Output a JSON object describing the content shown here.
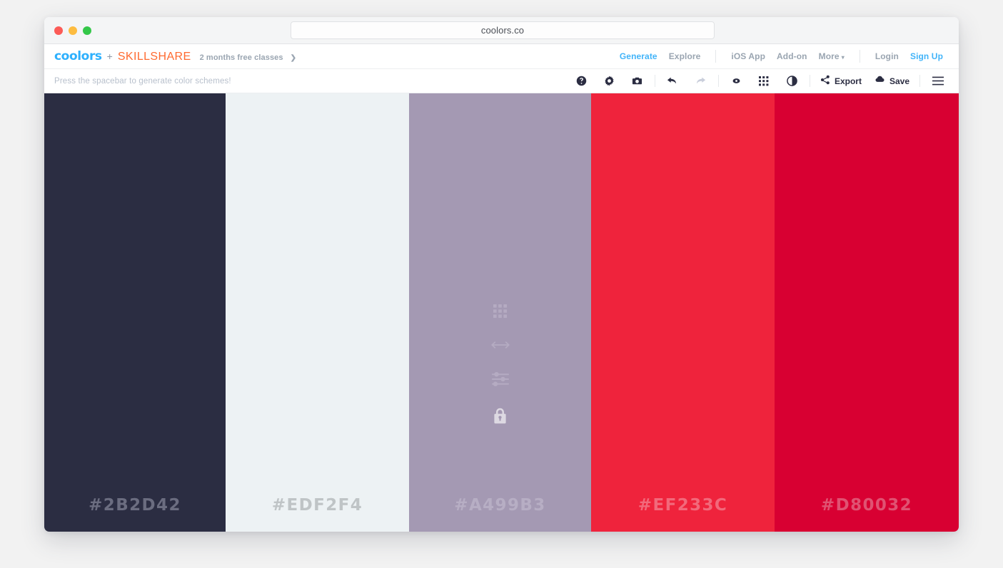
{
  "browser": {
    "url": "coolors.co",
    "traffic_lights": [
      "close-red",
      "minimize-yellow",
      "maximize-green"
    ]
  },
  "header": {
    "logo": "coolors",
    "plus": "+",
    "partner": "SKILLSHARE",
    "promo": "2 months free classes",
    "promo_arrow": "❯",
    "nav_primary": [
      {
        "label": "Generate",
        "active": true
      },
      {
        "label": "Explore",
        "active": false
      }
    ],
    "nav_secondary": [
      {
        "label": "iOS App",
        "caret": false
      },
      {
        "label": "Add-on",
        "caret": false
      },
      {
        "label": "More",
        "caret": true
      }
    ],
    "nav_account": [
      {
        "label": "Login",
        "accent": false
      },
      {
        "label": "Sign Up",
        "accent": true
      }
    ],
    "caret_glyph": "▾"
  },
  "toolbar": {
    "hint": "Press the spacebar to generate color schemes!",
    "icons": [
      {
        "name": "help-icon",
        "disabled": false
      },
      {
        "name": "gear-icon",
        "disabled": false
      },
      {
        "name": "camera-icon",
        "disabled": false
      },
      {
        "name": "undo-icon",
        "disabled": false
      },
      {
        "name": "redo-icon",
        "disabled": true
      },
      {
        "name": "eye-icon",
        "disabled": false
      },
      {
        "name": "grid-icon",
        "disabled": false
      },
      {
        "name": "contrast-icon",
        "disabled": false
      }
    ],
    "export_label": "Export",
    "save_label": "Save",
    "menu_label": "menu"
  },
  "palette": {
    "swatches": [
      {
        "hex": "#2B2D42",
        "label": "#2B2D42",
        "label_color": "#6b6d80",
        "show_icons": false
      },
      {
        "hex": "#EDF2F4",
        "label": "#EDF2F4",
        "label_color": "#bfc4c6",
        "show_icons": false
      },
      {
        "hex": "#A499B3",
        "label": "#A499B3",
        "label_color": "#b7aec4",
        "show_icons": true
      },
      {
        "hex": "#EF233C",
        "label": "#EF233C",
        "label_color": "#f2697b",
        "show_icons": false
      },
      {
        "hex": "#D80032",
        "label": "#D80032",
        "label_color": "#e05272",
        "show_icons": false
      }
    ],
    "hover_icons": [
      {
        "name": "grid-dots-icon"
      },
      {
        "name": "drag-horizontal-icon"
      },
      {
        "name": "adjust-sliders-icon"
      },
      {
        "name": "lock-icon"
      }
    ]
  },
  "colors": {
    "accent_blue": "#42b4f9",
    "brand_blue": "#2db0fd",
    "brand_orange": "#ff6a30",
    "toolbar_dark": "#2b2d42",
    "muted_gray": "#9aa5b1"
  }
}
